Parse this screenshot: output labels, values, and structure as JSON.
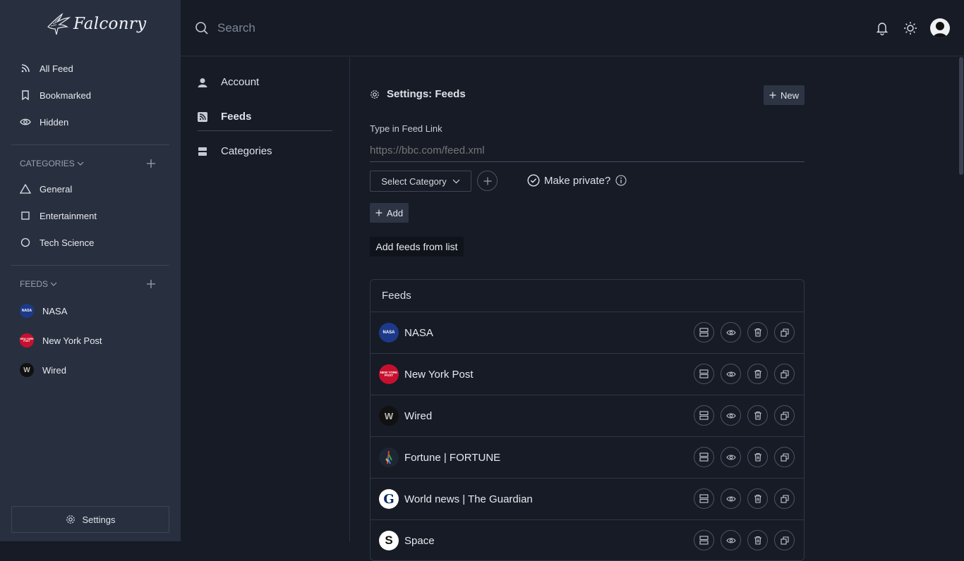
{
  "app": {
    "name": "Falconry"
  },
  "sidebar": {
    "nav": [
      {
        "label": "All Feed",
        "icon": "rss-icon"
      },
      {
        "label": "Bookmarked",
        "icon": "bookmark-icon"
      },
      {
        "label": "Hidden",
        "icon": "eye-icon"
      }
    ],
    "categories_heading": "CATEGORIES",
    "categories": [
      {
        "label": "General",
        "icon": "triangle-icon"
      },
      {
        "label": "Entertainment",
        "icon": "square-icon"
      },
      {
        "label": "Tech Science",
        "icon": "circle-icon"
      }
    ],
    "feeds_heading": "FEEDS",
    "feeds": [
      {
        "label": "NASA",
        "badge": "NASA"
      },
      {
        "label": "New York Post",
        "badge": "NEW YORK POST"
      },
      {
        "label": "Wired",
        "badge": "W"
      }
    ],
    "settings_label": "Settings"
  },
  "topbar": {
    "search_placeholder": "Search"
  },
  "settings_nav": [
    {
      "label": "Account",
      "icon": "user-icon",
      "active": false
    },
    {
      "label": "Feeds",
      "icon": "rss-square-icon",
      "active": true
    },
    {
      "label": "Categories",
      "icon": "category-icon",
      "active": false
    }
  ],
  "main": {
    "title": "Settings: Feeds",
    "new_label": "New",
    "field_label": "Type in Feed Link",
    "field_placeholder": "https://bbc.com/feed.xml",
    "select_label": "Select Category",
    "private_label": "Make private?",
    "add_label": "Add",
    "list_button_label": "Add feeds from list",
    "table_title": "Feeds",
    "feeds": [
      {
        "name": "NASA",
        "badge": "NASA"
      },
      {
        "name": "New York Post",
        "badge": "NEW YORK POST"
      },
      {
        "name": "Wired",
        "badge": "W"
      },
      {
        "name": "Fortune | FORTUNE",
        "badge": ""
      },
      {
        "name": "World news | The Guardian",
        "badge": "G"
      },
      {
        "name": "Space",
        "badge": "S"
      }
    ]
  },
  "colors": {
    "sidebar_bg": "#283040",
    "app_bg": "#161b26",
    "nasa": "#1d3a8a",
    "nypost": "#c8102e",
    "wired": "#111111"
  }
}
